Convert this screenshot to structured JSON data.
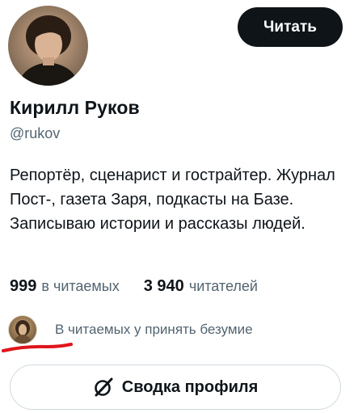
{
  "profile": {
    "name": "Кирилл Руков",
    "handle": "@rukov",
    "bio": "Репортёр, сценарист и гострайтер. Журнал Пост-, газета Заря, подкасты на Базе. Записываю истории и рассказы людей.",
    "avatar_icon": "avatar-photo"
  },
  "actions": {
    "follow_label": "Читать",
    "summary_label": "Сводка профиля",
    "summary_icon": "grok-slash-icon"
  },
  "stats": {
    "following_count": "999",
    "following_label": "в читаемых",
    "followers_count": "3 940",
    "followers_label": "читателей"
  },
  "followed_by": {
    "text": "В читаемых у принять безумие",
    "underline_color": "#e0151b"
  },
  "colors": {
    "primary_text": "#0f1419",
    "secondary_text": "#536471",
    "button_dark": "#0f1419",
    "border": "#cfd9de"
  }
}
